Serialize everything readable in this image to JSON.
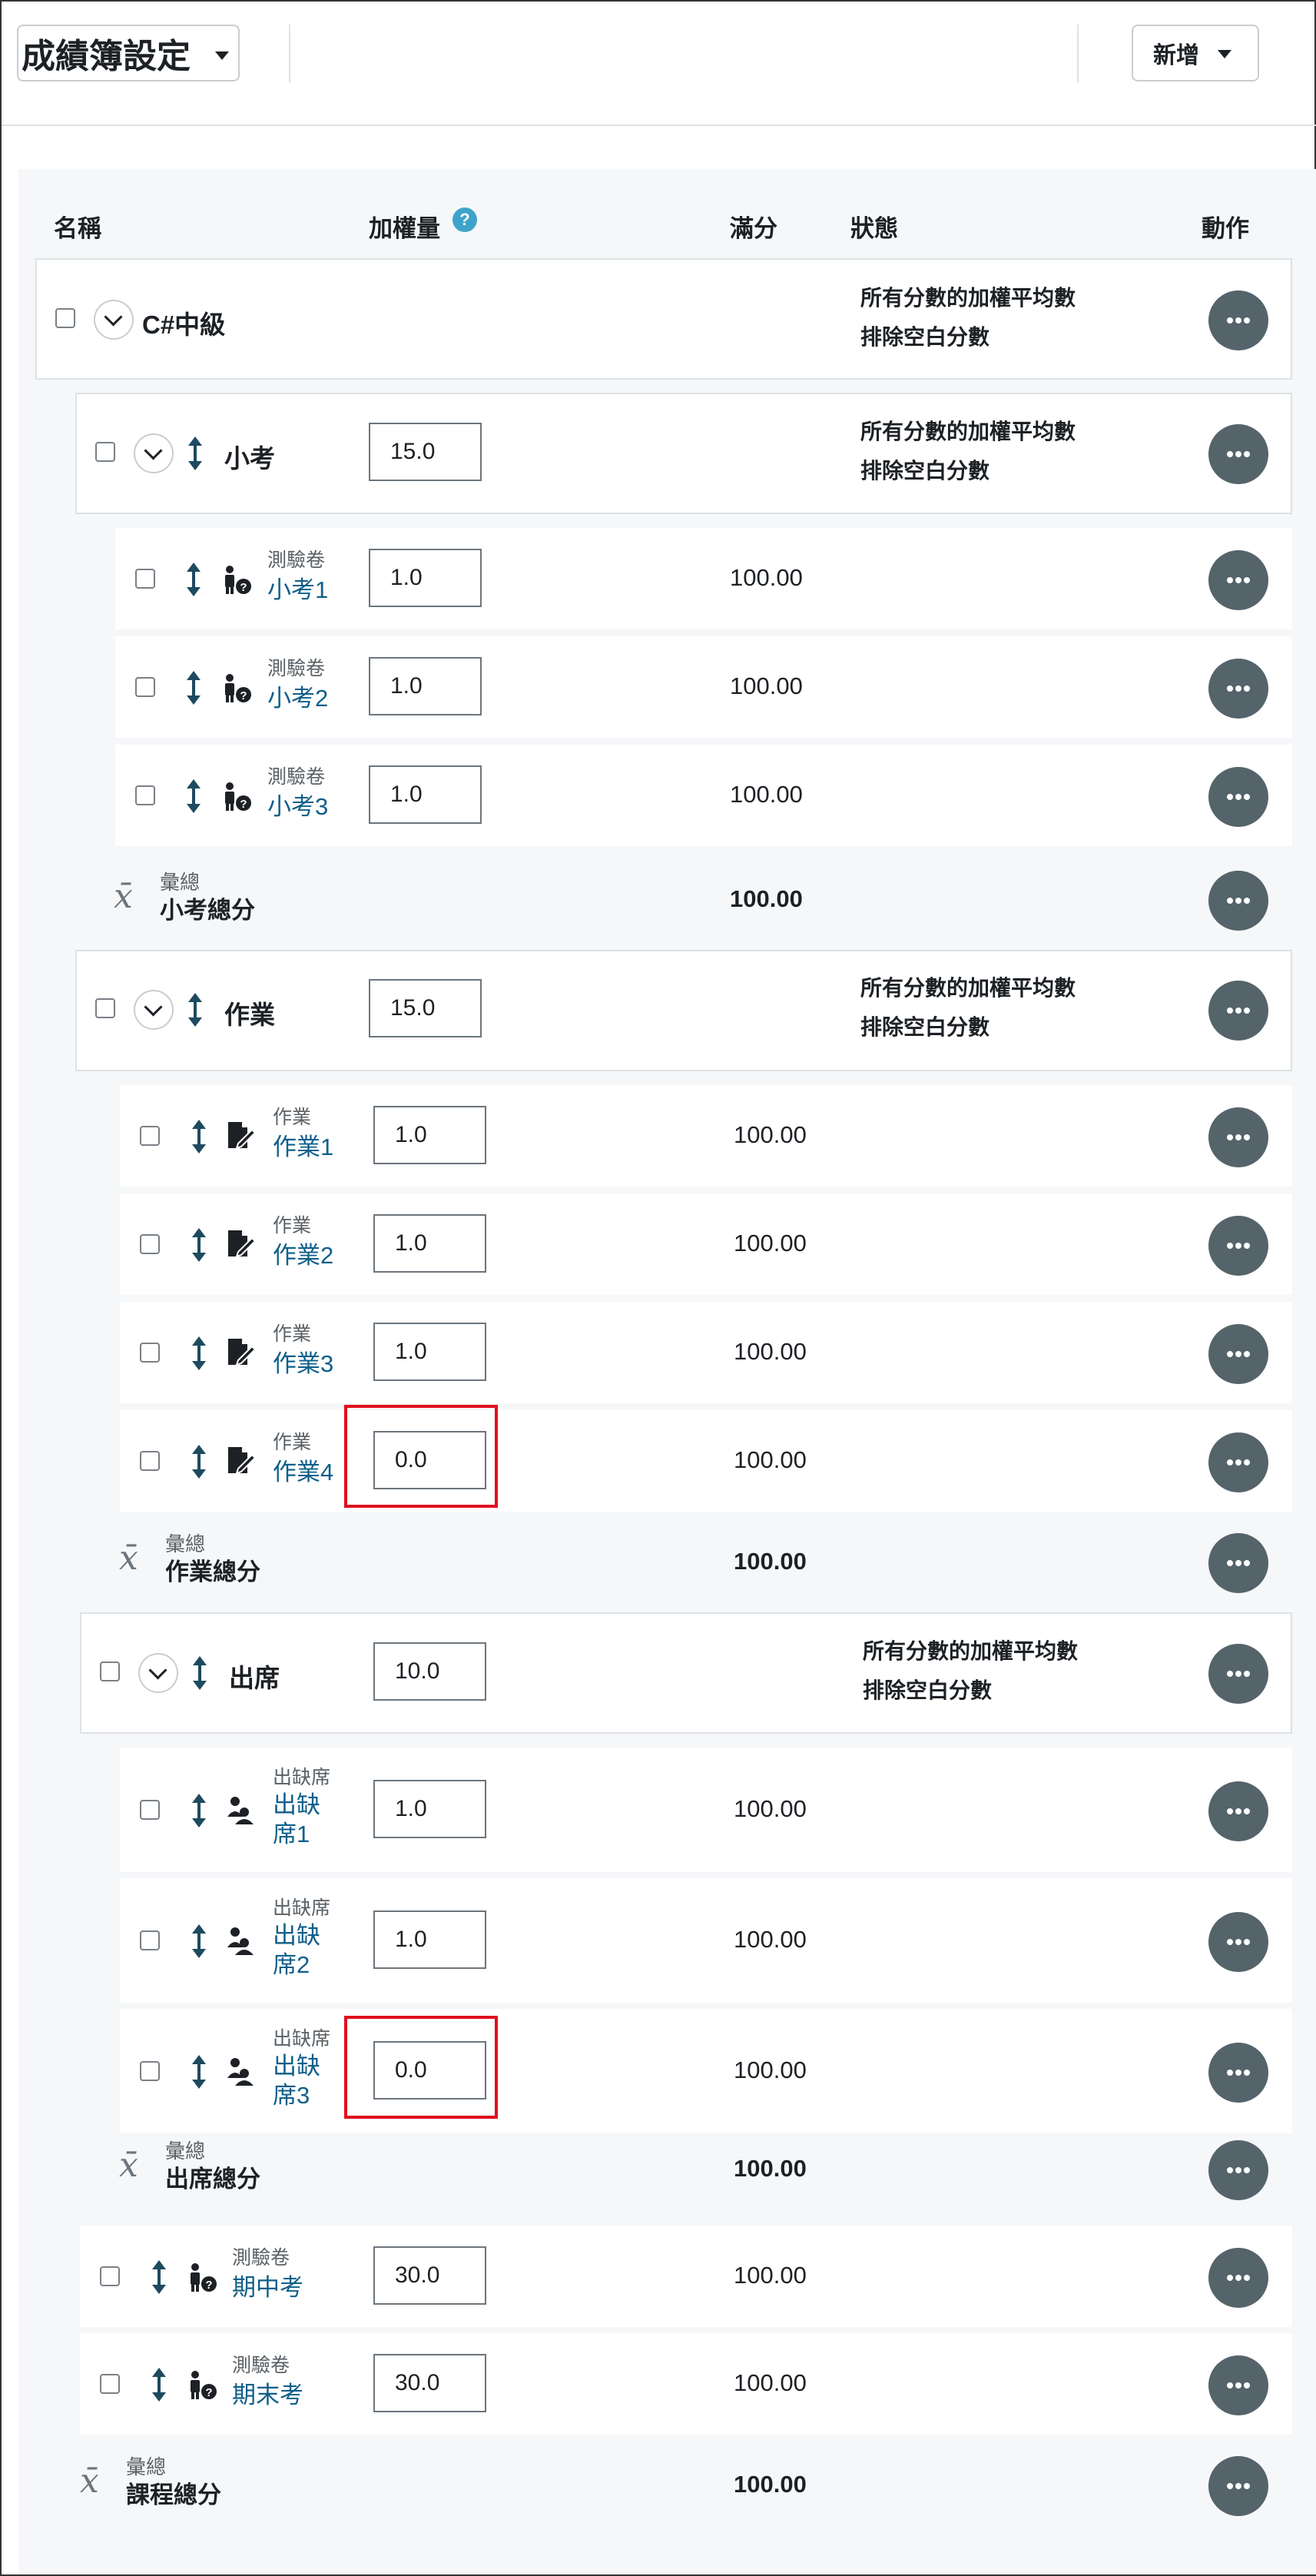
{
  "header": {
    "title": "成績簿設定",
    "add_label": "新增"
  },
  "columns": {
    "name": "名稱",
    "weight": "加權量",
    "help": "?",
    "max": "滿分",
    "status": "狀態",
    "actions": "動作"
  },
  "status_lines": [
    "所有分數的加權平均數",
    "排除空白分數"
  ],
  "course": {
    "name": "C#中級"
  },
  "categories": [
    {
      "name": "小考",
      "weight": "15.0",
      "item_type": "測驗卷",
      "items": [
        {
          "name": "小考1",
          "weight": "1.0",
          "max": "100.00"
        },
        {
          "name": "小考2",
          "weight": "1.0",
          "max": "100.00"
        },
        {
          "name": "小考3",
          "weight": "1.0",
          "max": "100.00"
        }
      ],
      "total_label": "彙總",
      "total_name": "小考總分",
      "total_max": "100.00"
    },
    {
      "name": "作業",
      "weight": "15.0",
      "item_type": "作業",
      "items": [
        {
          "name": "作業1",
          "weight": "1.0",
          "max": "100.00"
        },
        {
          "name": "作業2",
          "weight": "1.0",
          "max": "100.00"
        },
        {
          "name": "作業3",
          "weight": "1.0",
          "max": "100.00"
        },
        {
          "name": "作業4",
          "weight": "0.0",
          "max": "100.00"
        }
      ],
      "total_label": "彙總",
      "total_name": "作業總分",
      "total_max": "100.00"
    },
    {
      "name": "出席",
      "weight": "10.0",
      "item_type": "出缺席",
      "items": [
        {
          "name_line1": "出缺",
          "name_line2": "席1",
          "weight": "1.0",
          "max": "100.00"
        },
        {
          "name_line1": "出缺",
          "name_line2": "席2",
          "weight": "1.0",
          "max": "100.00"
        },
        {
          "name_line1": "出缺",
          "name_line2": "席3",
          "weight": "0.0",
          "max": "100.00"
        }
      ],
      "total_label": "彙總",
      "total_name": "出席總分",
      "total_max": "100.00"
    }
  ],
  "exams": [
    {
      "type": "測驗卷",
      "name": "期中考",
      "weight": "30.0",
      "max": "100.00"
    },
    {
      "type": "測驗卷",
      "name": "期末考",
      "weight": "30.0",
      "max": "100.00"
    }
  ],
  "course_total": {
    "label": "彙總",
    "name": "課程總分",
    "max": "100.00"
  },
  "colors": {
    "action_button": "#55636b",
    "highlight": "#e0101e",
    "link": "#0f5f8a",
    "help_badge": "#3fa3c9"
  },
  "icons": [
    "chevron-down-icon",
    "move-icon",
    "quiz-icon",
    "assignment-icon",
    "attendance-icon",
    "xbar-icon",
    "more-icon",
    "help-icon"
  ]
}
